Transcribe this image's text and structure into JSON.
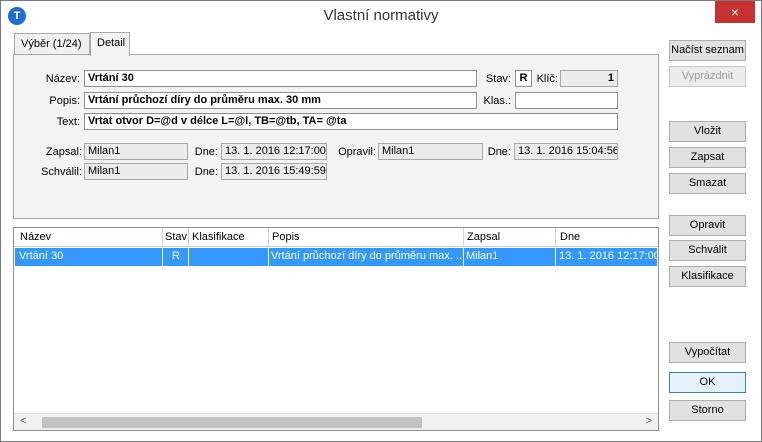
{
  "window": {
    "title": "Vlastní normativy",
    "app_icon": "T",
    "close_icon": "×"
  },
  "tabs": [
    {
      "label": "Výběr (1/24)"
    },
    {
      "label": "Detail"
    }
  ],
  "detail": {
    "nazev_label": "Název:",
    "nazev_value": "Vrtání 30",
    "stav_label": "Stav:",
    "stav_value": "R",
    "klic_label": "Klíč:",
    "klic_value": "1",
    "popis_label": "Popis:",
    "popis_value": "Vrtání průchozí díry do průměru max. 30 mm",
    "klas_label": "Klas.:",
    "klas_value": "",
    "text_label": "Text:",
    "text_value": "Vrtat otvor D=@d v délce L=@l, TB=@tb, TA= @ta",
    "zapsal_label": "Zapsal:",
    "zapsal_value": "Milan1",
    "zapsal_dne_label": "Dne:",
    "zapsal_dne_value": "13. 1. 2016 12:17:00",
    "opravil_label": "Opravil:",
    "opravil_value": "Milan1",
    "opravil_dne_label": "Dne:",
    "opravil_dne_value": "13. 1. 2016 15:04:56",
    "schvalil_label": "Schválil:",
    "schvalil_value": "Milan1",
    "schvalil_dne_label": "Dne:",
    "schvalil_dne_value": "13. 1. 2016 15:49:59"
  },
  "grid": {
    "columns": [
      "Název",
      "Stav",
      "Klasifikace",
      "Popis",
      "Zapsal",
      "Dne"
    ],
    "rows": [
      {
        "nazev": "Vrtání 30",
        "stav": "R",
        "klasifikace": "",
        "popis": "Vrtání průchozí díry do průměru max. ...",
        "zapsal": "Milan1",
        "dne": "13. 1. 2016 12:17:00"
      }
    ],
    "scroll_left": "<",
    "scroll_right": ">"
  },
  "buttons": {
    "nacist": "Načíst seznam",
    "vyprazdnit": "Vyprázdnit",
    "vlozit": "Vložit",
    "zapsat": "Zapsat",
    "smazat": "Smazat",
    "opravit": "Opravit",
    "schvalit": "Schválit",
    "klasifikace": "Klasifikace",
    "vypocitat": "Vypočítat",
    "ok": "OK",
    "storno": "Storno"
  }
}
